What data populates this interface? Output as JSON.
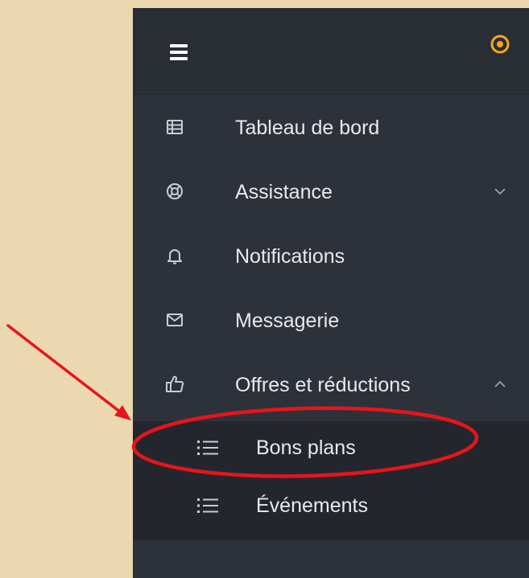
{
  "colors": {
    "page_background": "#ebd7b0",
    "sidebar_background": "#2d323a",
    "topbar_background": "#292e35",
    "submenu_background": "#23272d",
    "text": "#e8e9eb",
    "icon": "#c9ccd1",
    "accent": "#f5a623",
    "annotation": "#e8141b"
  },
  "topbar": {
    "menu_icon": "hamburger-icon",
    "action_icon": "target-icon"
  },
  "menu": {
    "items": [
      {
        "label": "Tableau de bord",
        "icon": "table-icon"
      },
      {
        "label": "Assistance",
        "icon": "lifebuoy-icon",
        "chevron": "down"
      },
      {
        "label": "Notifications",
        "icon": "bell-icon"
      },
      {
        "label": "Messagerie",
        "icon": "envelope-icon"
      },
      {
        "label": "Offres et réductions",
        "icon": "thumbs-up-icon",
        "chevron": "up"
      }
    ],
    "submenu": [
      {
        "label": "Bons plans",
        "icon": "list-icon",
        "highlighted": true
      },
      {
        "label": "Événements",
        "icon": "list-icon"
      }
    ]
  }
}
